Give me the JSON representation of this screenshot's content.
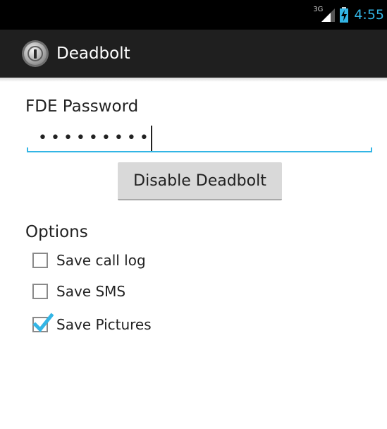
{
  "status_bar": {
    "network_type": "3G",
    "time": "4:55",
    "icons": [
      "signal-icon",
      "battery-charging-icon"
    ]
  },
  "action_bar": {
    "title": "Deadbolt",
    "icon": "deadbolt-lock-icon"
  },
  "form": {
    "password_label": "FDE Password",
    "password_value": "•••••••••",
    "disable_button_label": "Disable Deadbolt"
  },
  "options": {
    "heading": "Options",
    "items": [
      {
        "label": "Save call log",
        "checked": false
      },
      {
        "label": "Save SMS",
        "checked": false
      },
      {
        "label": "Save Pictures",
        "checked": true
      }
    ]
  },
  "colors": {
    "accent": "#33b5e5",
    "action_bar": "#1f1f1f",
    "status_bar": "#000000",
    "button": "#d9d9d9"
  }
}
